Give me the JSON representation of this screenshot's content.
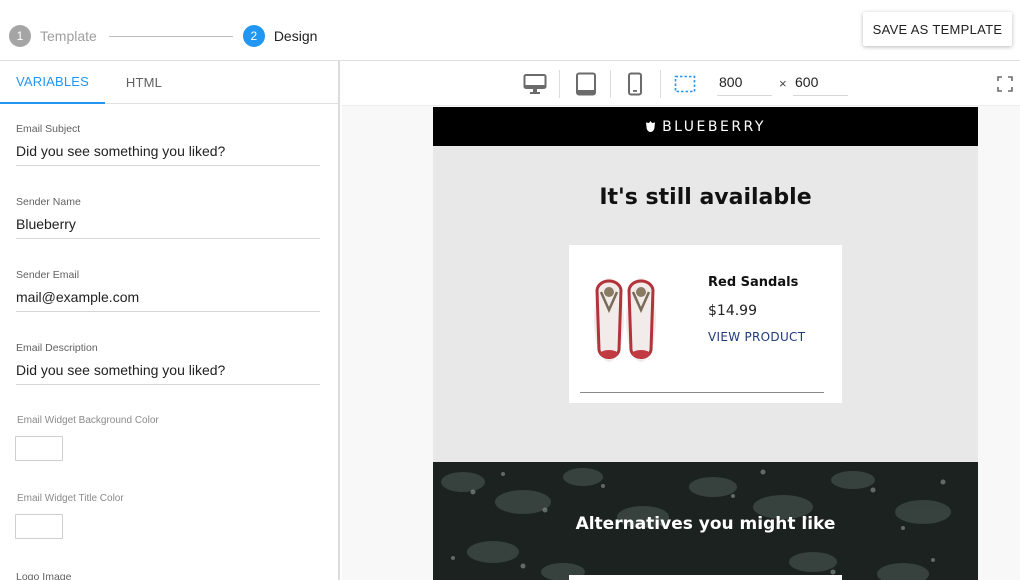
{
  "stepper": {
    "steps": [
      {
        "number": "1",
        "label": "Template"
      },
      {
        "number": "2",
        "label": "Design"
      }
    ]
  },
  "header": {
    "save_label": "SAVE AS TEMPLATE"
  },
  "left_panel": {
    "tabs": [
      {
        "label": "VARIABLES"
      },
      {
        "label": "HTML"
      }
    ],
    "fields": [
      {
        "label": "Email Subject",
        "value": "Did you see something you liked?"
      },
      {
        "label": "Sender Name",
        "value": "Blueberry"
      },
      {
        "label": "Sender Email",
        "value": "mail@example.com"
      },
      {
        "label": "Email Description",
        "value": "Did you see something you liked?"
      }
    ],
    "color_fields": [
      {
        "label": "Email Widget Background Color",
        "color": "#ffffff"
      },
      {
        "label": "Email Widget Title Color",
        "color": "#ffffff"
      }
    ],
    "logo_label": "Logo Image"
  },
  "toolbar": {
    "width": "800",
    "times": "×",
    "height": "600"
  },
  "email": {
    "brand": "BLUEBERRY",
    "headline": "It's still available",
    "product": {
      "name": "Red Sandals",
      "price": "$14.99",
      "link": "VIEW PRODUCT"
    },
    "section_title": "Alternatives you might like"
  },
  "colors": {
    "accent": "#2196f3",
    "brand_bar": "#000000",
    "email_bg": "#e8e8e8",
    "link": "#1e3a7a"
  }
}
